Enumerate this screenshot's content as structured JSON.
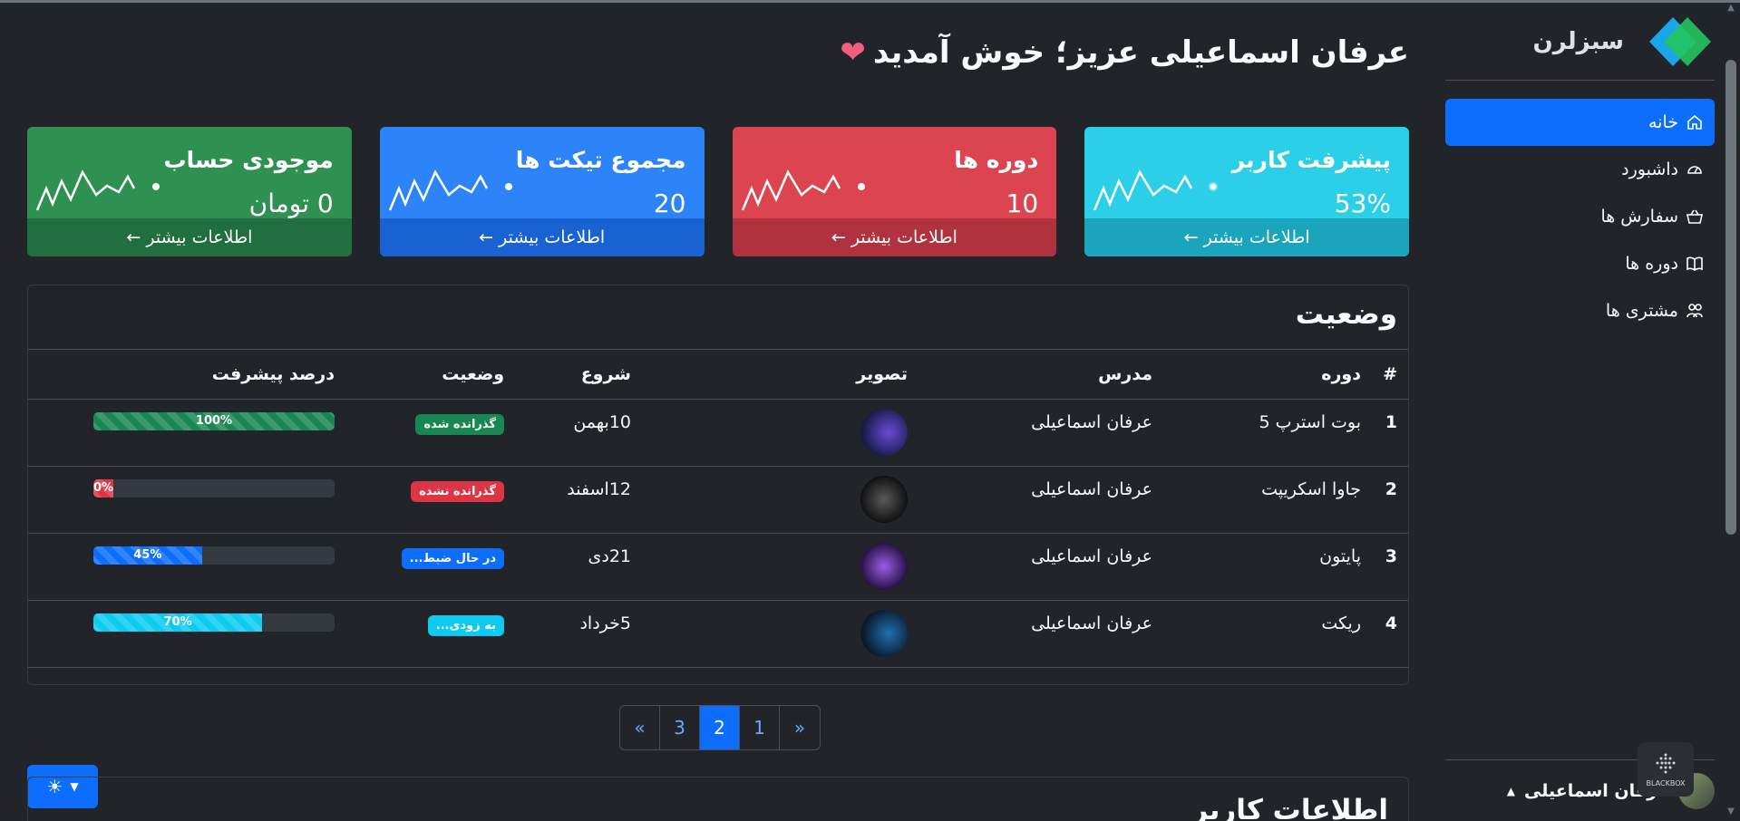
{
  "brand": {
    "name": "سبزلرن"
  },
  "sidebar": {
    "items": [
      {
        "label": "خانه",
        "icon": "home-icon",
        "active": true
      },
      {
        "label": "داشبورد",
        "icon": "speedometer-icon",
        "active": false
      },
      {
        "label": "سفارش ها",
        "icon": "basket-icon",
        "active": false
      },
      {
        "label": "دوره ها",
        "icon": "book-icon",
        "active": false
      },
      {
        "label": "مشتری ها",
        "icon": "people-icon",
        "active": false
      }
    ],
    "user_name": "عرفان اسماعیلی"
  },
  "welcome": {
    "text": "عرفان اسماعیلی عزیز؛ خوش آمدید"
  },
  "cards": [
    {
      "title": "پیشرفت کاربر",
      "value": "53%",
      "footer": "اطلاعات بیشتر ←",
      "color": "#2ccfe8"
    },
    {
      "title": "دوره ها",
      "value": "10",
      "footer": "اطلاعات بیشتر ←",
      "color": "#dc4450"
    },
    {
      "title": "مجموع تیکت ها",
      "value": "20",
      "footer": "اطلاعات بیشتر ←",
      "color": "#2d84f8"
    },
    {
      "title": "موجودی حساب",
      "value": "0 تومان",
      "footer": "اطلاعات بیشتر ←",
      "color": "#2e9152"
    }
  ],
  "status": {
    "title": "وضعیت",
    "headers": [
      "#",
      "دوره",
      "مدرس",
      "تصویر",
      "شروع",
      "وضعیت",
      "درصد پیشرفت"
    ],
    "rows": [
      {
        "num": "1",
        "course": "بوت استرپ 5",
        "teacher": "عرفان اسماعیلی",
        "start": "10بهمن",
        "status": "گذرانده شده",
        "progress": 100,
        "progress_label": "100%"
      },
      {
        "num": "2",
        "course": "جاوا اسکریپت",
        "teacher": "عرفان اسماعیلی",
        "start": "12اسفند",
        "status": "گذرانده نشده",
        "progress": 0,
        "progress_label": "0%"
      },
      {
        "num": "3",
        "course": "پایتون",
        "teacher": "عرفان اسماعیلی",
        "start": "21دی",
        "status": "در حال ضبط...",
        "progress": 45,
        "progress_label": "45%"
      },
      {
        "num": "4",
        "course": "ریکت",
        "teacher": "عرفان اسماعیلی",
        "start": "5خرداد",
        "status": "به زودی...",
        "progress": 70,
        "progress_label": "70%"
      }
    ]
  },
  "pagination": {
    "items": [
      "«",
      "3",
      "2",
      "1",
      "»"
    ],
    "active": "2"
  },
  "user_info": {
    "title": "اطلاعات کاربر"
  },
  "overlay": {
    "label": "BLACKBOX"
  }
}
